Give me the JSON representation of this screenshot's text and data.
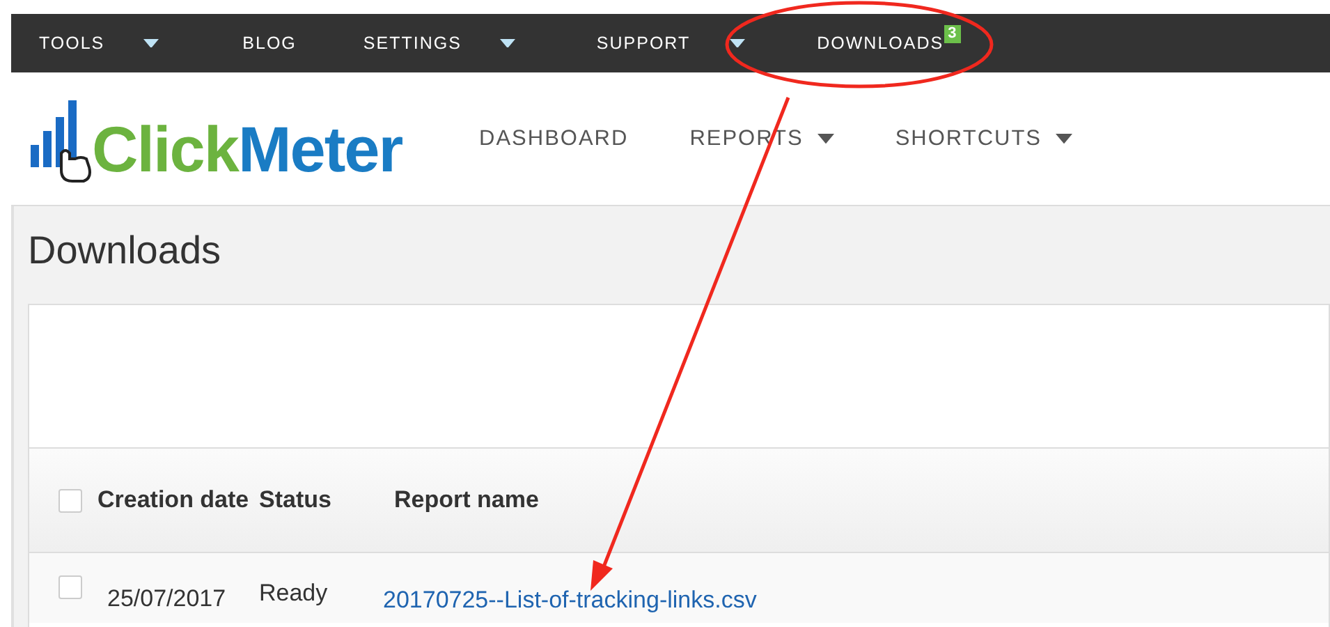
{
  "top_menu": [
    {
      "label": "TOOLS",
      "dropdown": true
    },
    {
      "label": "BLOG",
      "dropdown": false
    },
    {
      "label": "SETTINGS",
      "dropdown": true
    },
    {
      "label": "SUPPORT",
      "dropdown": true
    },
    {
      "label": "DOWNLOADS",
      "dropdown": false,
      "badge": "3"
    }
  ],
  "logo": {
    "parts": [
      "Click",
      "Meter"
    ]
  },
  "main_nav": [
    {
      "label": "DASHBOARD",
      "dropdown": false
    },
    {
      "label": "REPORTS",
      "dropdown": true
    },
    {
      "label": "SHORTCUTS",
      "dropdown": true
    }
  ],
  "page_title": "Downloads",
  "table": {
    "header_checked": false,
    "columns": [
      "Creation date",
      "Status",
      "Report name"
    ],
    "rows": [
      {
        "checked": false,
        "creation_date": "25/07/2017",
        "status": "Ready",
        "report_name": "20170725--List-of-tracking-links.csv"
      }
    ]
  },
  "annotations": [
    {
      "kind": "ellipse"
    },
    {
      "kind": "arrow"
    }
  ]
}
